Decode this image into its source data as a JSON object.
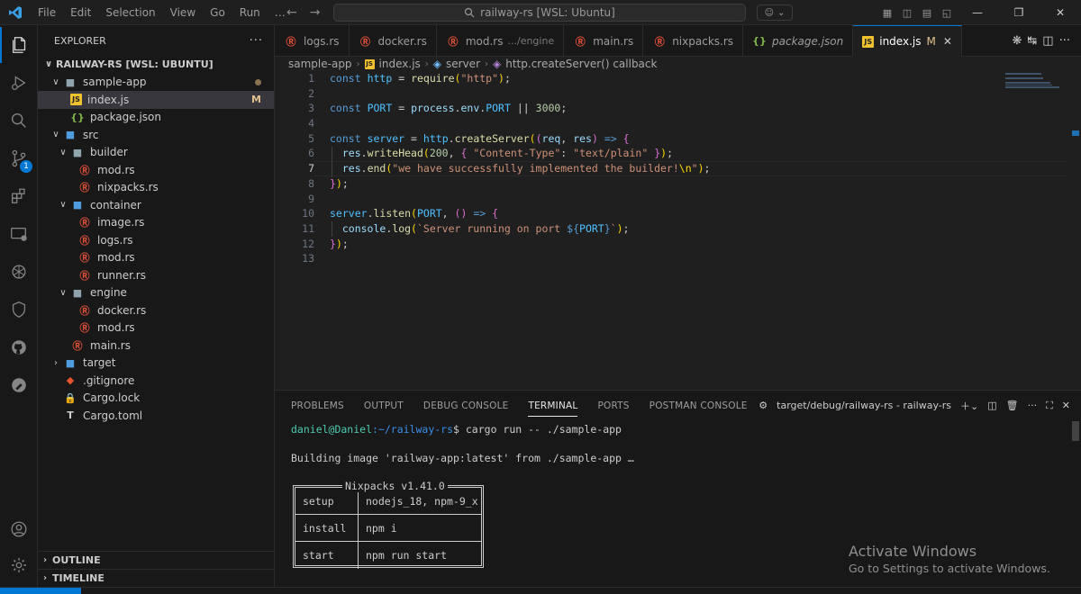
{
  "titlebar": {
    "menu": [
      "File",
      "Edit",
      "Selection",
      "View",
      "Go",
      "Run",
      "…"
    ],
    "search": "railway-rs [WSL: Ubuntu]"
  },
  "sidebar": {
    "title": "EXPLORER",
    "root": "RAILWAY-RS [WSL: UBUNTU]",
    "items": [
      {
        "label": "sample-app",
        "kind": "folder",
        "depth": 0,
        "open": true,
        "flag": "dot"
      },
      {
        "label": "index.js",
        "kind": "js",
        "depth": 1,
        "selected": true,
        "flag": "M"
      },
      {
        "label": "package.json",
        "kind": "json",
        "depth": 1
      },
      {
        "label": "src",
        "kind": "folder-src",
        "depth": 0,
        "open": true
      },
      {
        "label": "builder",
        "kind": "folder",
        "depth": 1,
        "open": true
      },
      {
        "label": "mod.rs",
        "kind": "rust",
        "depth": 2
      },
      {
        "label": "nixpacks.rs",
        "kind": "rust",
        "depth": 2
      },
      {
        "label": "container",
        "kind": "folder-src",
        "depth": 1,
        "open": true
      },
      {
        "label": "image.rs",
        "kind": "rust",
        "depth": 2
      },
      {
        "label": "logs.rs",
        "kind": "rust",
        "depth": 2
      },
      {
        "label": "mod.rs",
        "kind": "rust",
        "depth": 2
      },
      {
        "label": "runner.rs",
        "kind": "rust",
        "depth": 2
      },
      {
        "label": "engine",
        "kind": "folder",
        "depth": 1,
        "open": true
      },
      {
        "label": "docker.rs",
        "kind": "rust",
        "depth": 2
      },
      {
        "label": "mod.rs",
        "kind": "rust",
        "depth": 2
      },
      {
        "label": "main.rs",
        "kind": "rust",
        "depth": 1
      },
      {
        "label": "target",
        "kind": "folder-src",
        "depth": 0,
        "open": false
      },
      {
        "label": ".gitignore",
        "kind": "git",
        "depth": 0
      },
      {
        "label": "Cargo.lock",
        "kind": "lock",
        "depth": 0
      },
      {
        "label": "Cargo.toml",
        "kind": "toml",
        "depth": 0
      }
    ],
    "outline": "OUTLINE",
    "timeline": "TIMELINE",
    "source_control_badge": "1"
  },
  "tabs": [
    {
      "label": "logs.rs",
      "kind": "rust"
    },
    {
      "label": "docker.rs",
      "kind": "rust"
    },
    {
      "label": "mod.rs",
      "kind": "rust",
      "desc": ".../engine"
    },
    {
      "label": "main.rs",
      "kind": "rust"
    },
    {
      "label": "nixpacks.rs",
      "kind": "rust"
    },
    {
      "label": "package.json",
      "kind": "json",
      "italic": true
    },
    {
      "label": "index.js",
      "kind": "js",
      "active": true,
      "flag": "M"
    }
  ],
  "breadcrumb": [
    "sample-app",
    "index.js",
    "server",
    "http.createServer() callback"
  ],
  "editor": {
    "line_numbers": [
      "1",
      "2",
      "3",
      "4",
      "5",
      "6",
      "7",
      "8",
      "9",
      "10",
      "11",
      "12",
      "13"
    ],
    "current_line": 7
  },
  "panel": {
    "tabs": [
      "PROBLEMS",
      "OUTPUT",
      "DEBUG CONSOLE",
      "TERMINAL",
      "PORTS",
      "POSTMAN CONSOLE"
    ],
    "active_tab": "TERMINAL",
    "terminal_name": "target/debug/railway-rs - railway-rs",
    "prompt_user": "daniel@Daniel",
    "prompt_path": ":~/railway-rs",
    "prompt_cmd": "$ cargo run -- ./sample-app",
    "build_line": "Building image 'railway-app:latest' from ./sample-app …",
    "nixpacks_title": "Nixpacks v1.41.0",
    "nixpacks_rows": [
      {
        "key": "setup",
        "value": "nodejs_18, npm-9_x"
      },
      {
        "key": "install",
        "value": "npm i"
      },
      {
        "key": "start",
        "value": "npm run start"
      }
    ]
  },
  "watermark": {
    "line1": "Activate Windows",
    "line2": "Go to Settings to activate Windows."
  }
}
